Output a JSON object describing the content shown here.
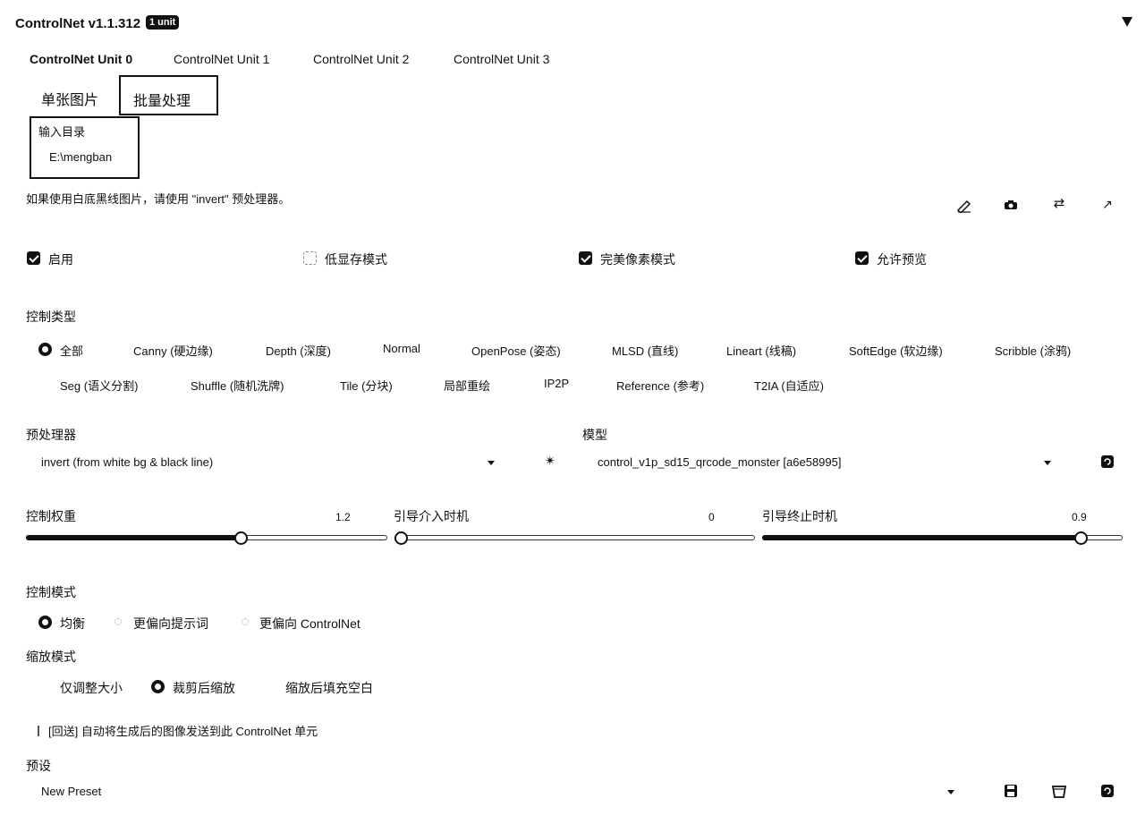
{
  "header": {
    "title": "ControlNet v1.1.312",
    "badge": "1 unit",
    "collapse_icon": "triangle-down-icon"
  },
  "unit_tabs": [
    "ControlNet Unit 0",
    "ControlNet Unit 1",
    "ControlNet Unit 2",
    "ControlNet Unit 3"
  ],
  "mode_tabs": [
    "单张图片",
    "批量处理"
  ],
  "input_dir": {
    "label": "输入目录",
    "value": "E:\\mengban"
  },
  "hint": "如果使用白底黑线图片，请使用 \"invert\" 预处理器。",
  "tool_icons": [
    "edit-icon",
    "camera-icon",
    "swap-icon",
    "send-icon"
  ],
  "checkboxes": [
    {
      "label": "启用",
      "checked": true
    },
    {
      "label": "低显存模式",
      "checked": false
    },
    {
      "label": "完美像素模式",
      "checked": true
    },
    {
      "label": "允许预览",
      "checked": true
    }
  ],
  "control_type": {
    "label": "控制类型",
    "options_row1": [
      "全部",
      "Canny (硬边缘)",
      "Depth (深度)",
      "Normal",
      "OpenPose (姿态)",
      "MLSD (直线)",
      "Lineart (线稿)",
      "SoftEdge (软边缘)",
      "Scribble (涂鸦)"
    ],
    "options_row2": [
      "Seg (语义分割)",
      "Shuffle (随机洗牌)",
      "Tile (分块)",
      "局部重绘",
      "IP2P",
      "Reference (参考)",
      "T2IA (自适应)"
    ],
    "selected": "全部"
  },
  "preprocessor": {
    "label": "预处理器",
    "value": "invert (from white bg & black line)",
    "run_icon": "explosion-icon"
  },
  "model": {
    "label": "模型",
    "value": "control_v1p_sd15_qrcode_monster [a6e58995]",
    "refresh_icon": "refresh-icon"
  },
  "sliders": [
    {
      "label": "控制权重",
      "value": "1.2"
    },
    {
      "label": "引导介入时机",
      "value": "0"
    },
    {
      "label": "引导终止时机",
      "value": "0.9"
    }
  ],
  "control_mode": {
    "label": "控制模式",
    "options": [
      "均衡",
      "更偏向提示词",
      "更偏向 ControlNet"
    ],
    "selected": "均衡"
  },
  "resize_mode": {
    "label": "缩放模式",
    "options": [
      "仅调整大小",
      "裁剪后缩放",
      "缩放后填充空白"
    ],
    "selected": "裁剪后缩放"
  },
  "loopback": {
    "label": "[回送] 自动将生成后的图像发送到此 ControlNet 单元",
    "checked": false
  },
  "preset": {
    "label": "预设",
    "value": "New Preset",
    "icons": [
      "save-icon",
      "delete-icon",
      "refresh-icon"
    ]
  }
}
